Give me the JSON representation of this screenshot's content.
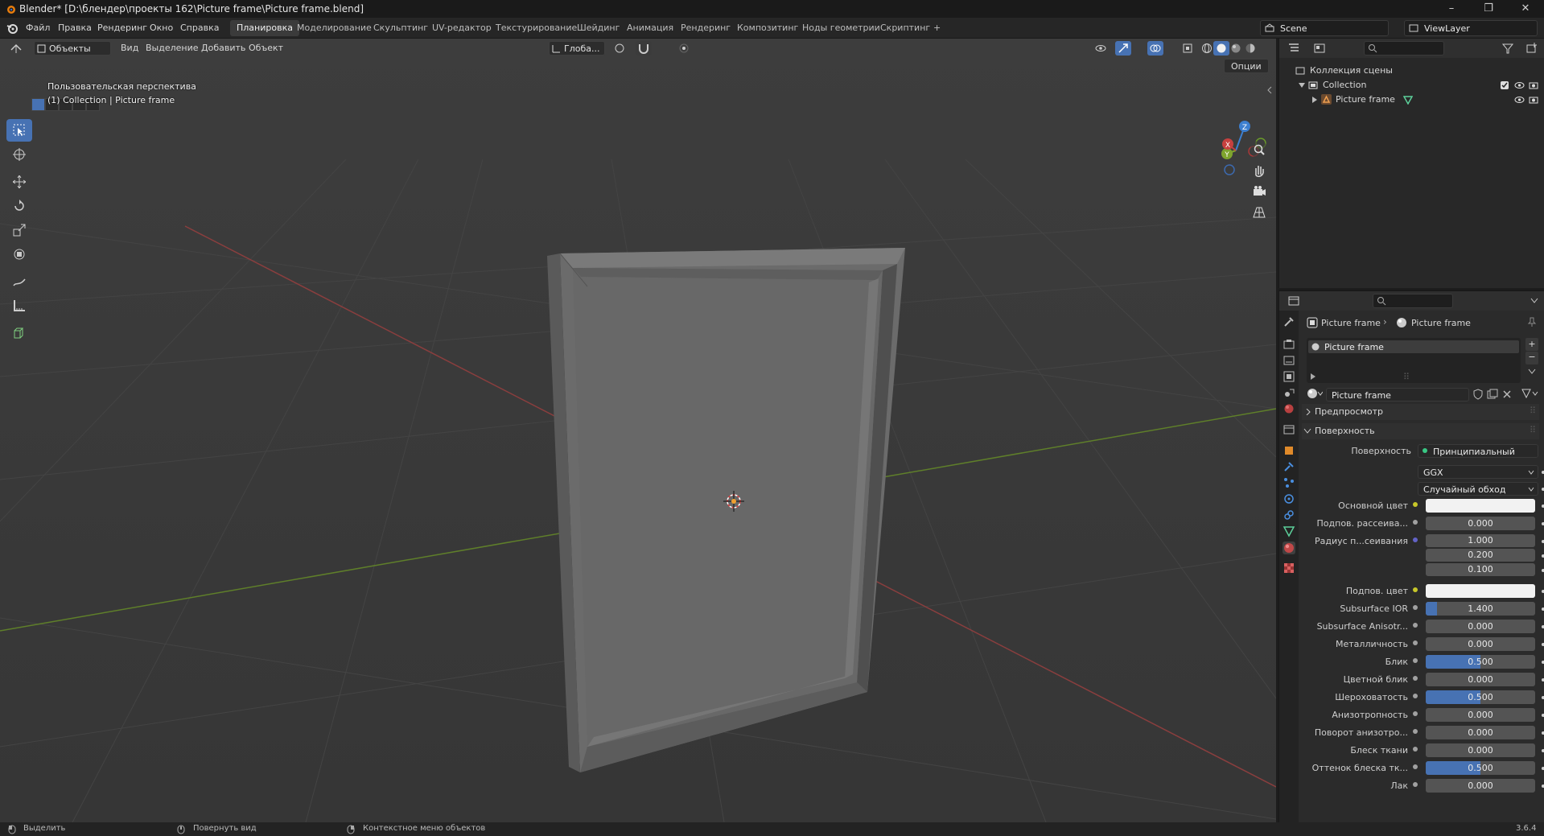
{
  "window": {
    "title": "Blender* [D:\\блендер\\проекты 162\\Picture frame\\Picture frame.blend]",
    "minimize": "–",
    "maximize": "❐",
    "close": "✕"
  },
  "menu": [
    "Файл",
    "Правка",
    "Рендеринг",
    "Окно",
    "Справка"
  ],
  "workspaces": [
    "Планировка",
    "Моделирование",
    "Скульптинг",
    "UV-редактор",
    "Текстурирование",
    "Шейдинг",
    "Анимация",
    "Рендеринг",
    "Композитинг",
    "Ноды геометрии",
    "Скриптинг",
    "+"
  ],
  "active_workspace": "Планировка",
  "scene": {
    "name": "Scene",
    "view_layer": "ViewLayer"
  },
  "viewport": {
    "mode": "Объекты",
    "menus": [
      "Вид",
      "Выделение",
      "Добавить",
      "Объект"
    ],
    "transform_orientation": "Глоба...",
    "options_label": "Опции",
    "overlay_line1": "Пользовательская перспектива",
    "overlay_line2": "(1) Collection | Picture frame",
    "gizmo": {
      "z": "Z",
      "y": "Y",
      "x": "X"
    }
  },
  "outliner": {
    "root": "Коллекция сцены",
    "collection": "Collection",
    "object": "Picture frame"
  },
  "properties": {
    "breadcrumb_object": "Picture frame",
    "breadcrumb_material": "Picture frame",
    "slot": "Picture frame",
    "material_name": "Picture frame",
    "sections": {
      "preview": "Предпросмотр",
      "surface": "Поверхность"
    },
    "surface_label": "Поверхность",
    "surface_shader": "Принципиальный BSDF",
    "distribution": "GGX",
    "subsurface_method": "Случайный обход",
    "rows": [
      {
        "label": "Основной цвет",
        "value": "",
        "type": "color",
        "color": "#f2f2f2",
        "socket": "#c7c729"
      },
      {
        "label": "Подпов. рассеива...",
        "value": "0.000",
        "type": "num",
        "fill": 0,
        "socket": "#a1a1a1"
      },
      {
        "label": "Радиус п...сеивания",
        "value": "1.000",
        "type": "vec",
        "fill": 0,
        "socket": "#6363c7"
      },
      {
        "label": "",
        "value": "0.200",
        "type": "vec2",
        "fill": 0
      },
      {
        "label": "",
        "value": "0.100",
        "type": "vec2",
        "fill": 0
      },
      {
        "label": "Подпов. цвет",
        "value": "",
        "type": "color",
        "color": "#f2f2f2",
        "socket": "#c7c729"
      },
      {
        "label": "Subsurface IOR",
        "value": "1.400",
        "type": "num",
        "fill": 0.1,
        "socket": "#a1a1a1"
      },
      {
        "label": "Subsurface Anisotr...",
        "value": "0.000",
        "type": "num",
        "fill": 0,
        "socket": "#a1a1a1"
      },
      {
        "label": "Металличность",
        "value": "0.000",
        "type": "num",
        "fill": 0,
        "socket": "#a1a1a1"
      },
      {
        "label": "Блик",
        "value": "0.500",
        "type": "num",
        "fill": 0.5,
        "socket": "#a1a1a1"
      },
      {
        "label": "Цветной блик",
        "value": "0.000",
        "type": "num",
        "fill": 0,
        "socket": "#a1a1a1"
      },
      {
        "label": "Шероховатость",
        "value": "0.500",
        "type": "num",
        "fill": 0.5,
        "socket": "#a1a1a1"
      },
      {
        "label": "Анизотропность",
        "value": "0.000",
        "type": "num",
        "fill": 0,
        "socket": "#a1a1a1"
      },
      {
        "label": "Поворот анизотро...",
        "value": "0.000",
        "type": "num",
        "fill": 0,
        "socket": "#a1a1a1"
      },
      {
        "label": "Блеск ткани",
        "value": "0.000",
        "type": "num",
        "fill": 0,
        "socket": "#a1a1a1"
      },
      {
        "label": "Оттенок блеска тк...",
        "value": "0.500",
        "type": "num",
        "fill": 0.5,
        "socket": "#a1a1a1"
      },
      {
        "label": "Лак",
        "value": "0.000",
        "type": "num",
        "fill": 0,
        "socket": "#a1a1a1"
      }
    ]
  },
  "status": {
    "select": "Выделить",
    "rotate": "Повернуть вид",
    "context": "Контекстное меню объектов",
    "version": "3.6.4"
  },
  "colors": {
    "accent": "#4772b3",
    "x_axis": "#c7403f",
    "y_axis": "#6f9a26",
    "z_axis": "#3c7fd0"
  }
}
